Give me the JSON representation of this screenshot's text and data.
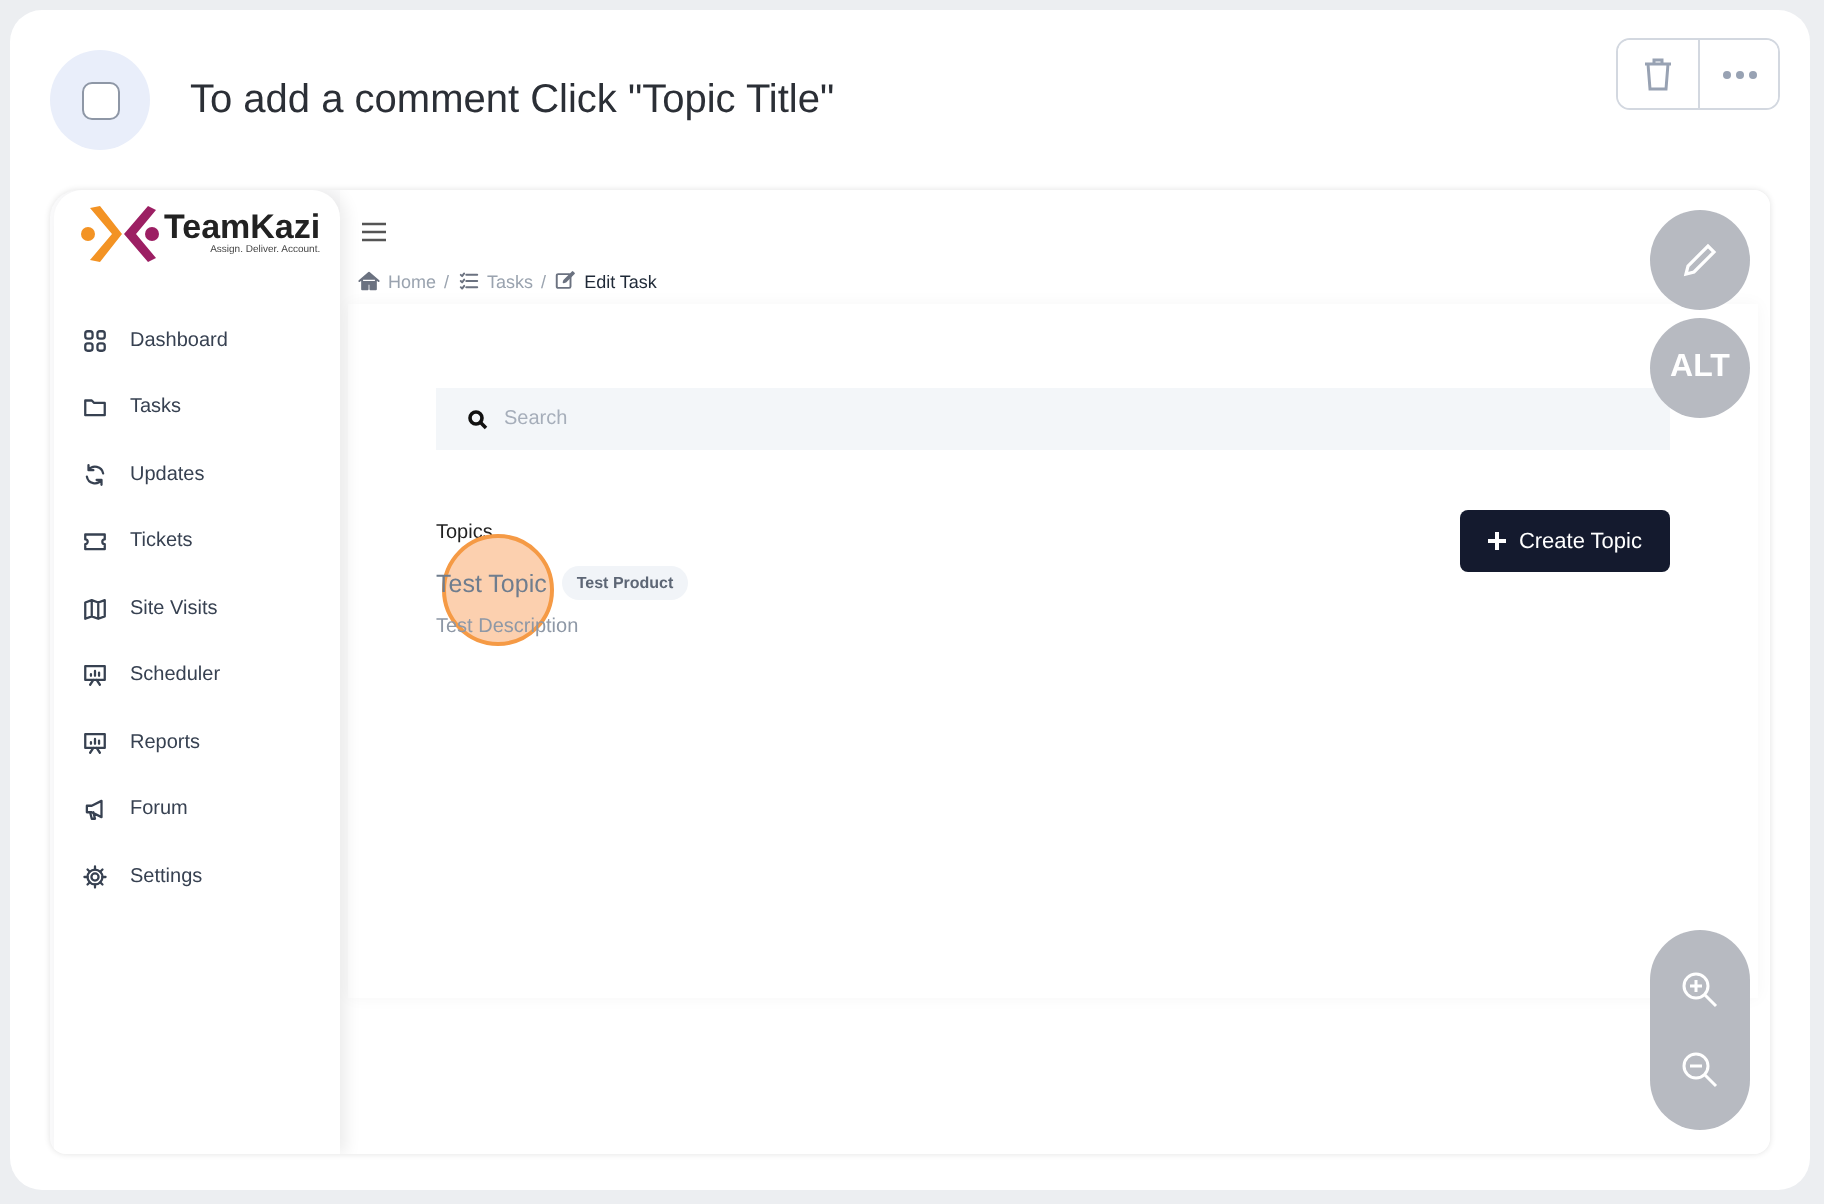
{
  "step": {
    "checked": false,
    "instruction": "To add a comment Click \"Topic Title\""
  },
  "app": {
    "logo": {
      "name": "TeamKazi",
      "tagline": "Assign. Deliver. Account."
    },
    "sidebar": {
      "items": [
        {
          "label": "Dashboard"
        },
        {
          "label": "Tasks"
        },
        {
          "label": "Updates"
        },
        {
          "label": "Tickets"
        },
        {
          "label": "Site Visits"
        },
        {
          "label": "Scheduler"
        },
        {
          "label": "Reports"
        },
        {
          "label": "Forum"
        },
        {
          "label": "Settings"
        }
      ]
    },
    "breadcrumb": [
      {
        "kind": "link",
        "label": "Home",
        "current": false
      },
      {
        "kind": "separator",
        "label": "/"
      },
      {
        "kind": "link",
        "label": "Tasks",
        "current": false
      },
      {
        "kind": "separator",
        "label": "/"
      },
      {
        "kind": "link",
        "label": "Edit Task",
        "current": true
      }
    ],
    "search": {
      "placeholder": "Search"
    },
    "topics_heading": "Topics",
    "create_button": "Create Topic",
    "topics": [
      {
        "title": "Test Topic",
        "tag": "Test Product",
        "description": "Test Description",
        "highlighted": true
      }
    ]
  },
  "overlay": {
    "alt_label": "ALT"
  }
}
